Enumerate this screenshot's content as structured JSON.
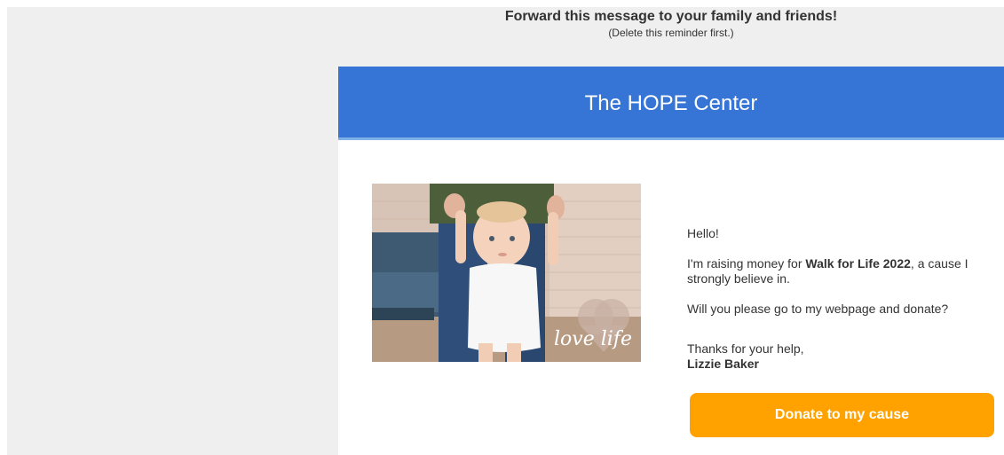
{
  "reminder": {
    "title": "Forward this message to your family and friends!",
    "subtitle": "(Delete this reminder first.)"
  },
  "header": {
    "title": "The HOPE Center"
  },
  "photo": {
    "overlay_text": "love life"
  },
  "message": {
    "greeting": "Hello!",
    "raising_prefix": "I'm raising money for ",
    "event_name": "Walk for Life 2022",
    "raising_suffix": ", a cause I strongly believe in.",
    "ask": "Will you please go to my webpage and donate?",
    "thanks": "Thanks for your help,",
    "sender_name": "Lizzie Baker"
  },
  "donate": {
    "label": "Donate to my cause"
  },
  "colors": {
    "header_bg": "#3675d6",
    "button_bg": "#ffa200",
    "page_bg": "#efefef",
    "text": "#333333"
  }
}
